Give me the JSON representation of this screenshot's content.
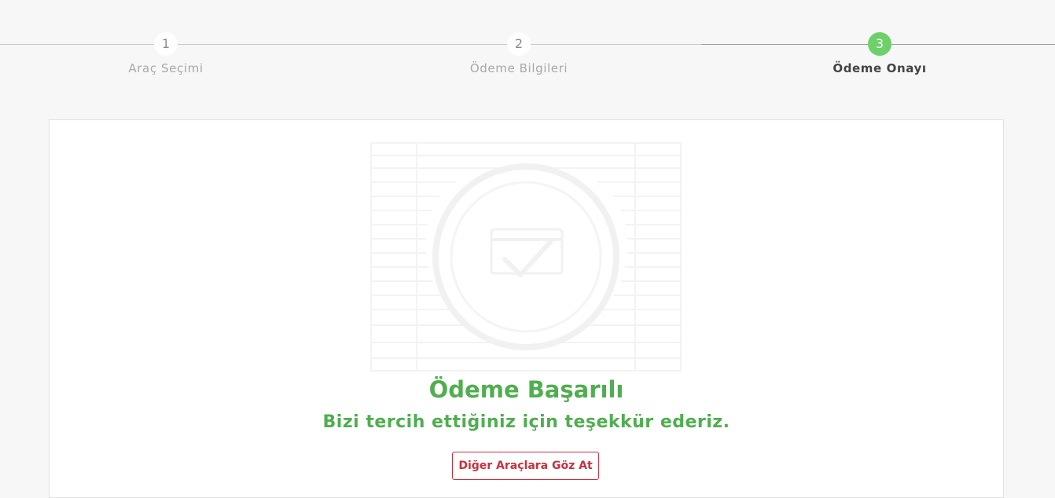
{
  "stepper": {
    "steps": [
      {
        "number": "1",
        "label": "Araç Seçimi"
      },
      {
        "number": "2",
        "label": "Ödeme Bilgileri"
      },
      {
        "number": "3",
        "label": "Ödeme Onayı"
      }
    ],
    "active_step": 3,
    "active_color": "#6cd06b"
  },
  "confirmation": {
    "illustration_icon": "payment-success-illustration",
    "title": "Ödeme Başarılı",
    "subtitle": "Bizi tercih ettiğiniz için teşekkür ederiz.",
    "button_label": "Diğer Araçlara Göz At",
    "accent_color": "#4fae4f",
    "button_color": "#c9303e"
  }
}
